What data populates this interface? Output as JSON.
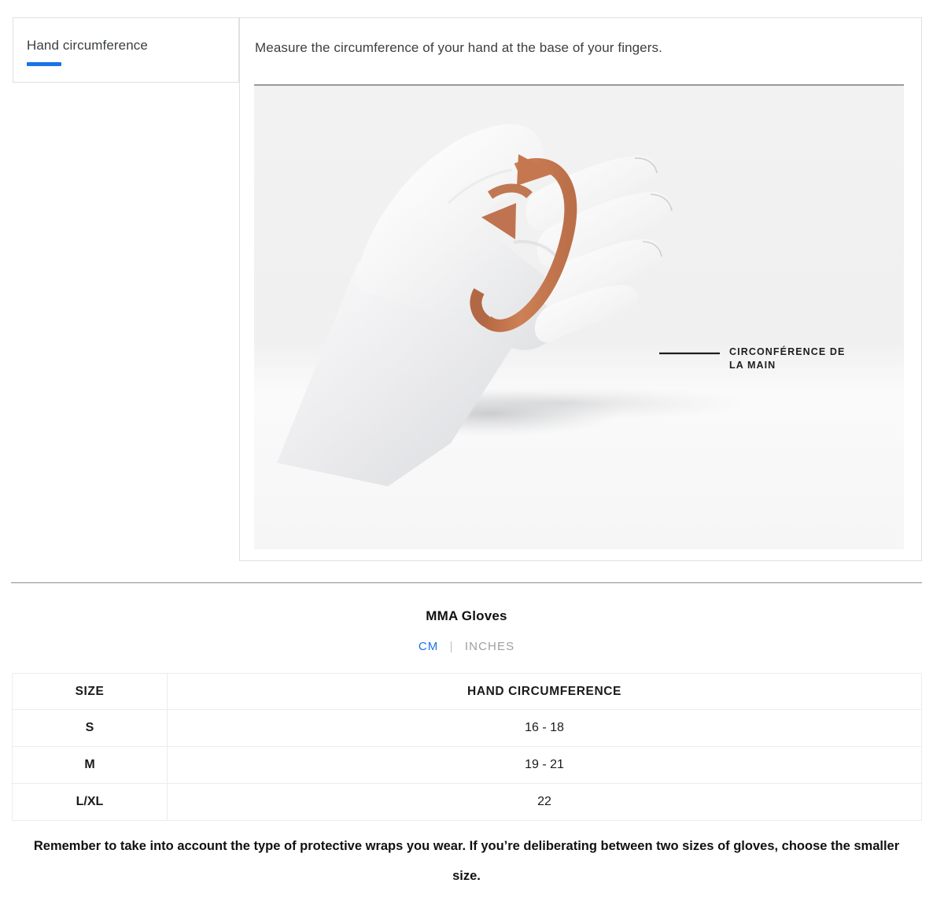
{
  "tabs": [
    {
      "label": "Hand circumference",
      "active": true,
      "accent": "#1a73e8"
    }
  ],
  "content": {
    "description": "Measure the circumference of your hand at the base of your fingers.",
    "illustration": {
      "alt_name": "hand-circumference-illustration",
      "caption_line1": "CIRCONFÉRENCE DE",
      "caption_line2": "LA MAIN",
      "band_color": "#c5784f",
      "hand_color": "#f1f1f1",
      "background_color": "#f3f3f3"
    }
  },
  "size_chart": {
    "title": "MMA Gloves",
    "units": {
      "primary": "CM",
      "separator": "|",
      "secondary": "INCHES",
      "selected": "CM",
      "active_color": "#1a73e8",
      "inactive_color": "#9e9e9e"
    },
    "columns": [
      "SIZE",
      "HAND CIRCUMFERENCE"
    ],
    "rows": [
      {
        "size": "S",
        "hand_circumference": "16 - 18"
      },
      {
        "size": "M",
        "hand_circumference": "19 - 21"
      },
      {
        "size": "L/XL",
        "hand_circumference": "22"
      }
    ],
    "footnote": "Remember to take into account the type of protective wraps you wear. If you’re deliberating between two sizes of gloves, choose the smaller size."
  },
  "chart_data": {
    "type": "table",
    "title": "MMA Gloves",
    "unit": "CM",
    "categories": [
      "S",
      "M",
      "L/XL"
    ],
    "xlabel": "SIZE",
    "ylabel": "HAND CIRCUMFERENCE",
    "series": [
      {
        "name": "HAND CIRCUMFERENCE",
        "values": [
          "16 - 18",
          "19 - 21",
          "22"
        ]
      }
    ],
    "ranges": [
      {
        "size": "S",
        "min": 16,
        "max": 18
      },
      {
        "size": "M",
        "min": 19,
        "max": 21
      },
      {
        "size": "L/XL",
        "min": 22,
        "max": 22
      }
    ]
  }
}
